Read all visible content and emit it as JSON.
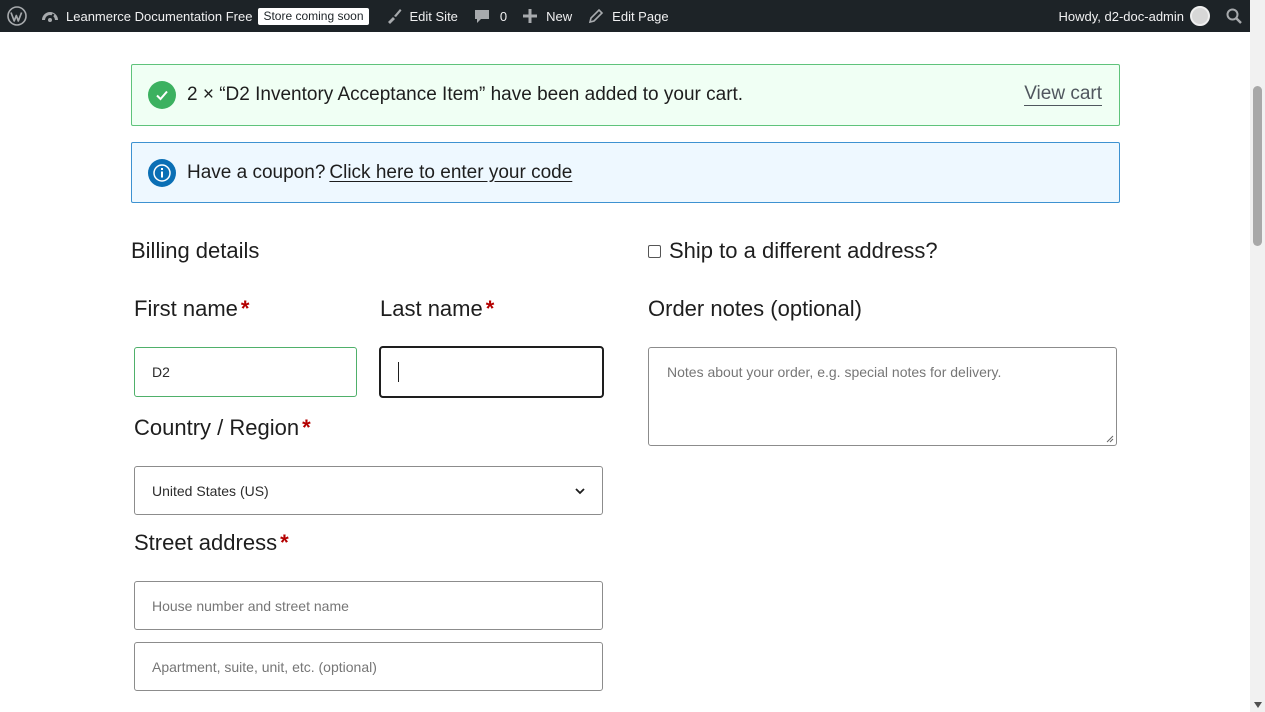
{
  "admin_bar": {
    "site_name": "Leanmerce Documentation Free",
    "store_badge": "Store coming soon",
    "edit_site": "Edit Site",
    "comments_count": "0",
    "new_label": "New",
    "edit_page": "Edit Page",
    "howdy": "Howdy, d2-doc-admin"
  },
  "notices": {
    "success_text": "2 × “D2 Inventory Acceptance Item” have been added to your cart.",
    "view_cart": "View cart",
    "coupon_text": "Have a coupon?",
    "coupon_link": "Click here to enter your code"
  },
  "billing": {
    "heading": "Billing details",
    "first_name_label": "First name",
    "first_name_value": "D2",
    "last_name_label": "Last name",
    "last_name_value": "",
    "country_label": "Country / Region",
    "country_value": "United States (US)",
    "street_label": "Street address",
    "street_placeholder": "House number and street name",
    "apartment_placeholder": "Apartment, suite, unit, etc. (optional)",
    "required_mark": "*"
  },
  "shipping": {
    "ship_different_label": "Ship to a different address?",
    "order_notes_label": "Order notes (optional)",
    "order_notes_placeholder": "Notes about your order, e.g. special notes for delivery."
  },
  "colors": {
    "admin_bar_bg": "#1d2327",
    "success_border": "#5fc37b",
    "info_border": "#3d92d1",
    "required": "#b40000"
  }
}
